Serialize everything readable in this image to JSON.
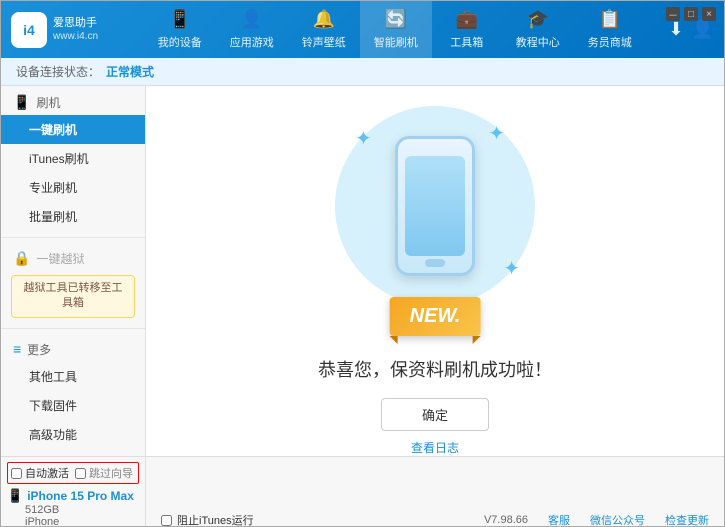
{
  "app": {
    "title": "爱思助手",
    "subtitle": "www.i4.cn"
  },
  "window_controls": {
    "minimize": "－",
    "maximize": "□",
    "close": "×"
  },
  "nav": {
    "items": [
      {
        "id": "my-device",
        "icon": "📱",
        "label": "我的设备"
      },
      {
        "id": "apps-games",
        "icon": "👤",
        "label": "应用游戏"
      },
      {
        "id": "ringtones",
        "icon": "🔔",
        "label": "铃声壁纸"
      },
      {
        "id": "smart-flash",
        "icon": "🔄",
        "label": "智能刷机",
        "active": true
      },
      {
        "id": "toolbox",
        "icon": "💼",
        "label": "工具箱"
      },
      {
        "id": "tutorial",
        "icon": "🎓",
        "label": "教程中心"
      },
      {
        "id": "service",
        "icon": "📋",
        "label": "务员商城"
      }
    ]
  },
  "header_actions": {
    "download": "⬇",
    "user": "👤"
  },
  "status_bar": {
    "label": "设备连接状态：",
    "value": "正常模式"
  },
  "sidebar": {
    "section_flash": {
      "icon": "📱",
      "label": "刷机"
    },
    "items": [
      {
        "id": "one-key-flash",
        "label": "一键刷机",
        "active": true
      },
      {
        "id": "itunes-flash",
        "label": "iTunes刷机"
      },
      {
        "id": "pro-flash",
        "label": "专业刷机"
      },
      {
        "id": "batch-flash",
        "label": "批量刷机"
      }
    ],
    "section_disabled": {
      "icon": "🔒",
      "label": "一键越狱"
    },
    "warning_text": "越狱工具已转移至工具箱",
    "section_more": {
      "icon": "≡",
      "label": "更多"
    },
    "more_items": [
      {
        "id": "other-tools",
        "label": "其他工具"
      },
      {
        "id": "download-firmware",
        "label": "下载固件"
      },
      {
        "id": "advanced",
        "label": "高级功能"
      }
    ]
  },
  "content": {
    "ribbon_text": "NEW.",
    "success_text": "恭喜您，保资料刷机成功啦！",
    "confirm_button": "确定",
    "log_link": "查看日志"
  },
  "device": {
    "auto_activate_label": "自动激活",
    "skip_guide_label": "跳过向导",
    "name": "iPhone 15 Pro Max",
    "storage": "512GB",
    "type": "iPhone",
    "icon": "📱"
  },
  "footer": {
    "itunes_label": "阻止iTunes运行",
    "version": "V7.98.66",
    "links": [
      "客服",
      "微信公众号",
      "检查更新"
    ]
  }
}
